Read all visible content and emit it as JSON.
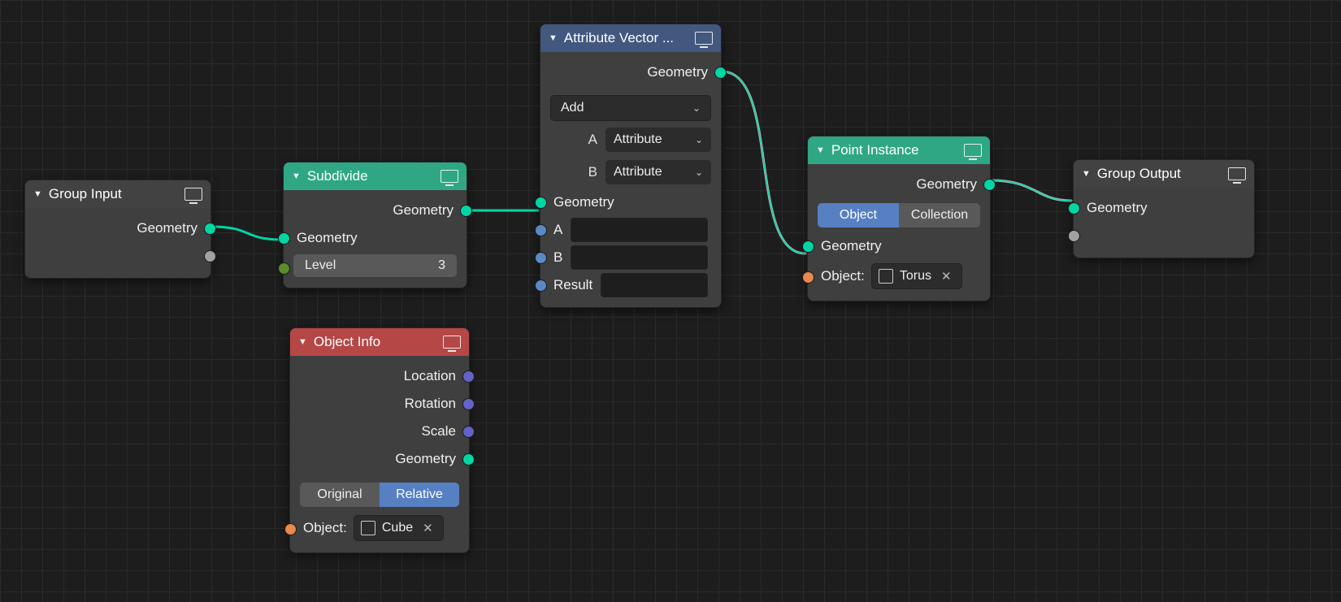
{
  "nodes": {
    "group_input": {
      "title": "Group Input",
      "out_geometry": "Geometry"
    },
    "subdivide": {
      "title": "Subdivide",
      "out_geometry": "Geometry",
      "in_geometry": "Geometry",
      "level_label": "Level",
      "level_value": "3"
    },
    "object_info": {
      "title": "Object Info",
      "out_location": "Location",
      "out_rotation": "Rotation",
      "out_scale": "Scale",
      "out_geometry": "Geometry",
      "toggle_original": "Original",
      "toggle_relative": "Relative",
      "object_label": "Object:",
      "object_name": "Cube"
    },
    "attr_vec": {
      "title": "Attribute Vector ...",
      "out_geometry": "Geometry",
      "operation": "Add",
      "a_label": "A",
      "a_mode": "Attribute",
      "b_label": "B",
      "b_mode": "Attribute",
      "in_geometry": "Geometry",
      "in_a": "A",
      "in_b": "B",
      "in_result": "Result"
    },
    "point_instance": {
      "title": "Point Instance",
      "out_geometry": "Geometry",
      "toggle_object": "Object",
      "toggle_collection": "Collection",
      "in_geometry": "Geometry",
      "object_label": "Object:",
      "object_name": "Torus"
    },
    "group_output": {
      "title": "Group Output",
      "in_geometry": "Geometry"
    }
  }
}
